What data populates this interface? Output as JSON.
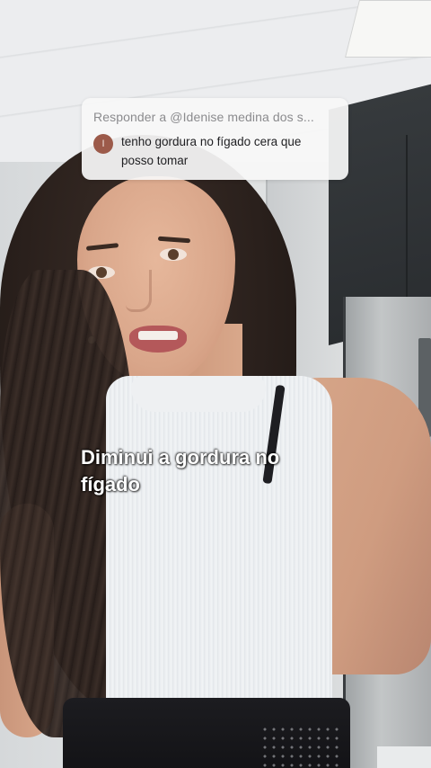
{
  "reply": {
    "header": "Responder a @Idenise medina dos s...",
    "avatar_initial": "I",
    "comment": "tenho gordura no fígado cera que posso tomar",
    "avatar_color": "#9c5a4a"
  },
  "caption": {
    "line1": "Diminui a gordura no",
    "line2": "fígado"
  }
}
